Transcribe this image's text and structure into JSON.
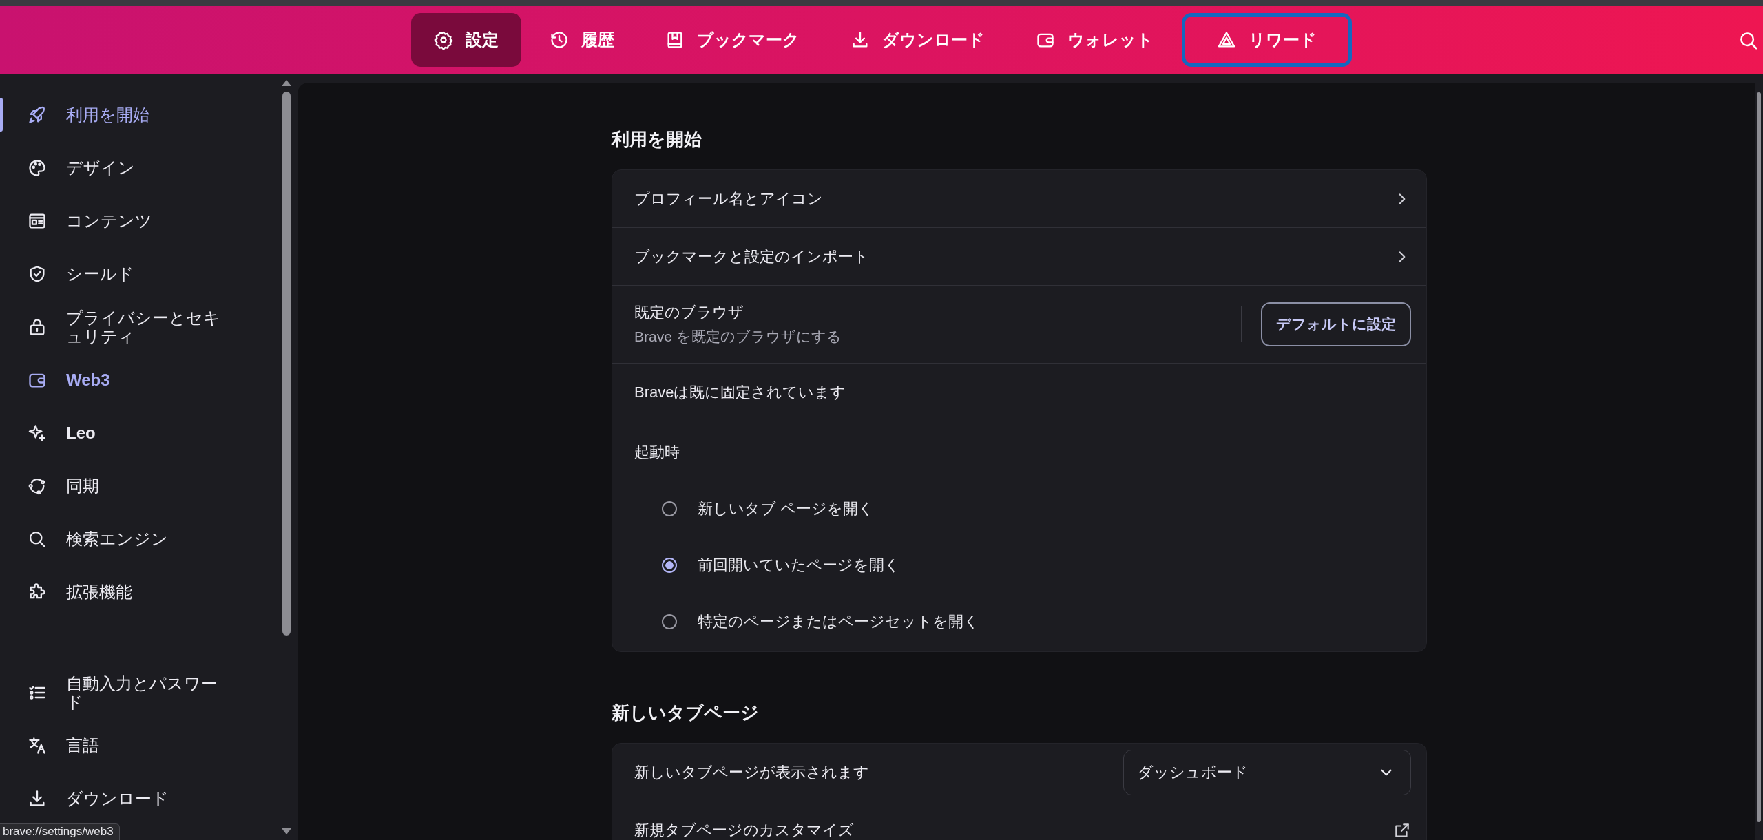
{
  "top_nav": {
    "tabs": [
      {
        "label": "設定",
        "selected": true,
        "highlighted": false
      },
      {
        "label": "履歴",
        "selected": false,
        "highlighted": false
      },
      {
        "label": "ブックマーク",
        "selected": false,
        "highlighted": false
      },
      {
        "label": "ダウンロード",
        "selected": false,
        "highlighted": false
      },
      {
        "label": "ウォレット",
        "selected": false,
        "highlighted": false
      },
      {
        "label": "リワード",
        "selected": false,
        "highlighted": true
      }
    ]
  },
  "sidebar": {
    "sections": [
      {
        "items": [
          {
            "label": "利用を開始",
            "selected": true,
            "hovered": false,
            "bold": false
          },
          {
            "label": "デザイン",
            "selected": false,
            "hovered": false,
            "bold": false
          },
          {
            "label": "コンテンツ",
            "selected": false,
            "hovered": false,
            "bold": false
          },
          {
            "label": "シールド",
            "selected": false,
            "hovered": false,
            "bold": false
          },
          {
            "label": "プライバシーとセキュリティ",
            "selected": false,
            "hovered": false,
            "bold": false
          },
          {
            "label": "Web3",
            "selected": false,
            "hovered": true,
            "bold": true
          },
          {
            "label": "Leo",
            "selected": false,
            "hovered": false,
            "bold": true
          },
          {
            "label": "同期",
            "selected": false,
            "hovered": false,
            "bold": false
          },
          {
            "label": "検索エンジン",
            "selected": false,
            "hovered": false,
            "bold": false
          },
          {
            "label": "拡張機能",
            "selected": false,
            "hovered": false,
            "bold": false
          }
        ]
      },
      {
        "items": [
          {
            "label": "自動入力とパスワード",
            "selected": false,
            "hovered": false,
            "bold": false
          },
          {
            "label": "言語",
            "selected": false,
            "hovered": false,
            "bold": false
          },
          {
            "label": "ダウンロード",
            "selected": false,
            "hovered": false,
            "bold": false
          }
        ]
      }
    ]
  },
  "status_url": "brave://settings/web3",
  "sections": [
    {
      "title": "利用を開始",
      "rows": [
        {
          "kind": "link",
          "label": "プロフィール名とアイコン"
        },
        {
          "kind": "link",
          "label": "ブックマークと設定のインポート"
        },
        {
          "kind": "button",
          "label": "既定のブラウザ",
          "sublabel": "Brave を既定のブラウザにする",
          "button": "デフォルトに設定"
        },
        {
          "kind": "text",
          "label": "Braveは既に固定されています"
        },
        {
          "kind": "radio_group",
          "label": "起動時",
          "options": [
            {
              "label": "新しいタブ ページを開く",
              "selected": false
            },
            {
              "label": "前回開いていたページを開く",
              "selected": true
            },
            {
              "label": "特定のページまたはページセットを開く",
              "selected": false
            }
          ]
        }
      ]
    },
    {
      "title": "新しいタブページ",
      "rows": [
        {
          "kind": "select",
          "label": "新しいタブページが表示されます",
          "value": "ダッシュボード"
        },
        {
          "kind": "external",
          "label": "新規タブページのカスタマイズ"
        }
      ]
    }
  ]
}
